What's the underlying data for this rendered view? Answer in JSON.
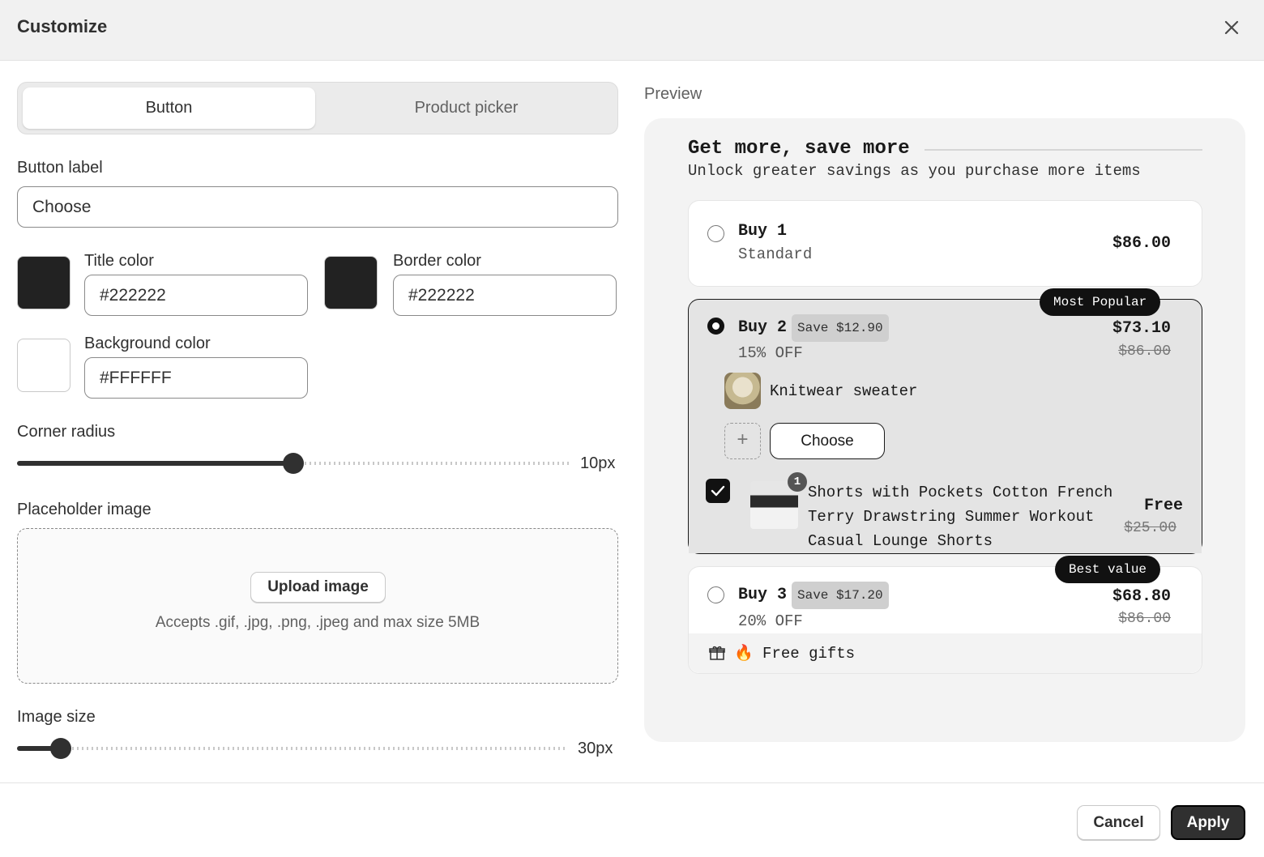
{
  "dialog": {
    "title": "Customize",
    "close_icon": "close-icon"
  },
  "tabs": [
    {
      "label": "Button",
      "active": true
    },
    {
      "label": "Product picker",
      "active": false
    }
  ],
  "button_label": {
    "label": "Button label",
    "value": "Choose"
  },
  "colors": {
    "title": {
      "label": "Title color",
      "value": "#222222",
      "swatch": "#222222"
    },
    "border": {
      "label": "Border color",
      "value": "#222222",
      "swatch": "#222222"
    },
    "background": {
      "label": "Background color",
      "value": "#FFFFFF",
      "swatch": "#FFFFFF"
    }
  },
  "corner_radius": {
    "label": "Corner radius",
    "value_text": "10px",
    "fraction": 0.5
  },
  "placeholder_image": {
    "label": "Placeholder image",
    "upload_label": "Upload image",
    "hint": "Accepts .gif, .jpg, .png, .jpeg and max size 5MB"
  },
  "image_size": {
    "label": "Image size",
    "value_text": "30px",
    "fraction": 0.08
  },
  "preview": {
    "label": "Preview",
    "heading": "Get more, save more",
    "subheading": "Unlock greater savings as you purchase more items",
    "options": [
      {
        "title": "Buy 1",
        "subtitle": "Standard",
        "price": "$86.00"
      },
      {
        "title": "Buy 2",
        "badge": "Save $12.90",
        "subtitle": "15% OFF",
        "price": "$73.10",
        "old_price": "$86.00",
        "tag": "Most Popular",
        "item": "Knitwear sweater",
        "choose_label": "Choose",
        "addon": {
          "quantity": "1",
          "name": "Shorts with Pockets Cotton French Terry Drawstring Summer Workout Casual Lounge Shorts",
          "price": "Free",
          "old_price": "$25.00"
        }
      },
      {
        "title": "Buy 3",
        "badge": "Save $17.20",
        "subtitle": "20% OFF",
        "price": "$68.80",
        "old_price": "$86.00",
        "tag": "Best value",
        "gift_text": "🔥 Free gifts"
      }
    ]
  },
  "footer": {
    "cancel_label": "Cancel",
    "apply_label": "Apply"
  },
  "accent": "#303030"
}
